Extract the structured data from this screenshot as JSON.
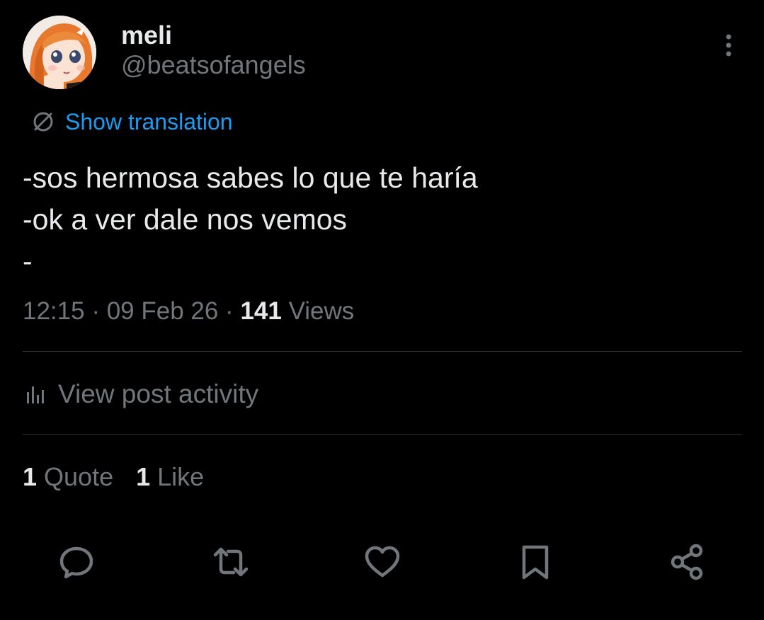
{
  "author": {
    "display_name": "meli",
    "handle": "@beatsofangels",
    "avatar_icon": "anime-girl-avatar"
  },
  "translation": {
    "label": "Show translation",
    "icon": "translate-icon",
    "color": "#1d9bf0"
  },
  "post": {
    "lines": [
      "-sos hermosa sabes lo que te haría",
      "-ok a ver dale nos vemos",
      "-"
    ]
  },
  "meta": {
    "time": "12:15",
    "separator": " · ",
    "date": "09 Feb 26",
    "views_count": "141",
    "views_label": " Views"
  },
  "activity": {
    "label": "View post activity",
    "icon": "analytics-icon"
  },
  "stats": {
    "quotes_count": "1",
    "quotes_label": " Quote",
    "likes_count": "1",
    "likes_label": " Like"
  },
  "actions": [
    {
      "name": "reply",
      "icon": "reply-icon"
    },
    {
      "name": "repost",
      "icon": "repost-icon"
    },
    {
      "name": "like",
      "icon": "heart-icon"
    },
    {
      "name": "bookmark",
      "icon": "bookmark-icon"
    },
    {
      "name": "share",
      "icon": "share-icon"
    }
  ],
  "colors": {
    "background": "#000000",
    "primary_text": "#e7e9ea",
    "secondary_text": "#71767b",
    "divider": "#2f3336",
    "accent": "#1d9bf0"
  }
}
